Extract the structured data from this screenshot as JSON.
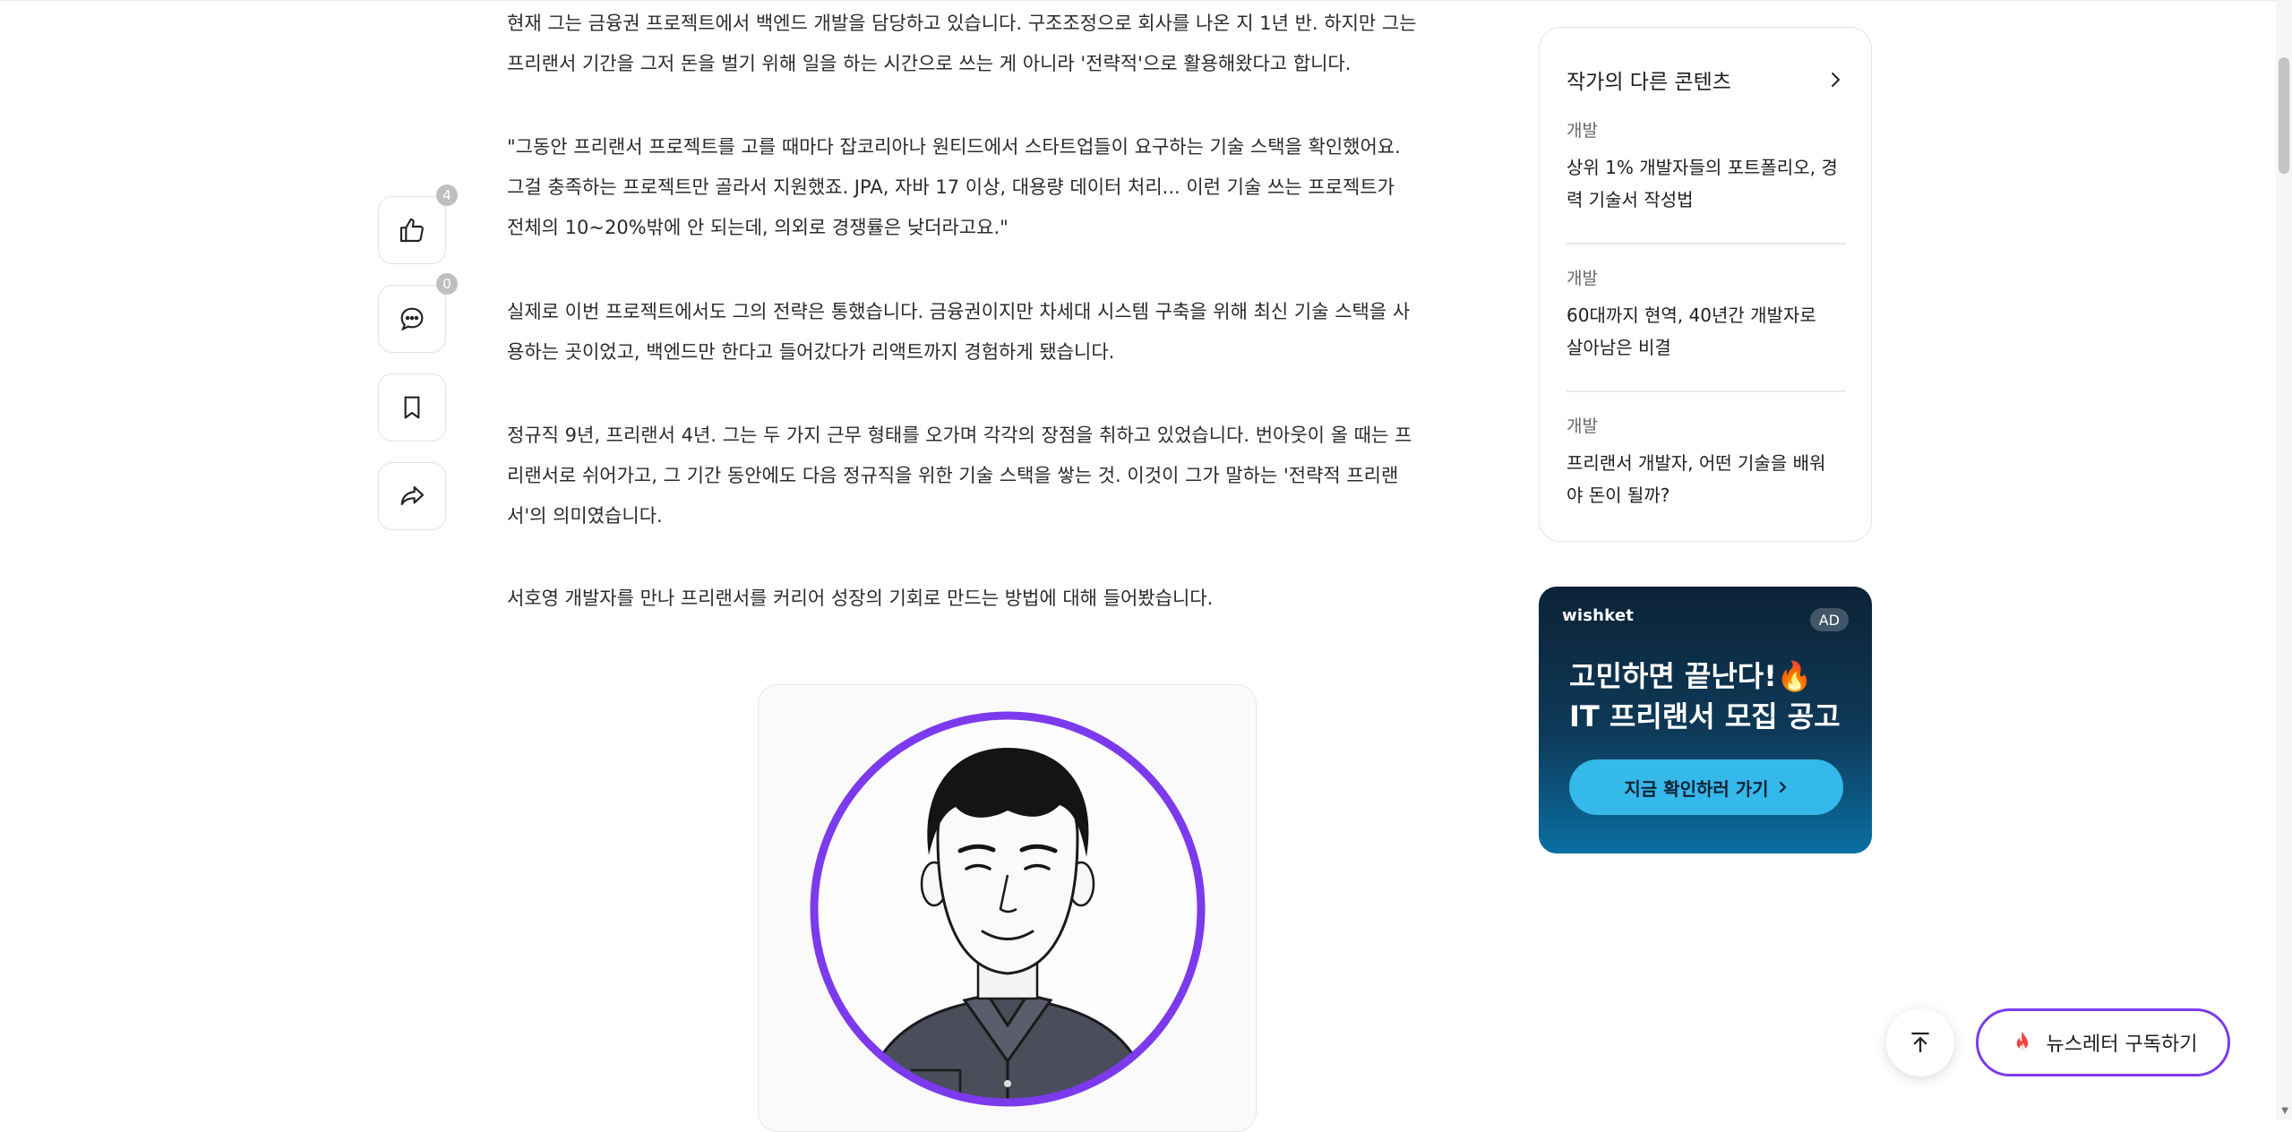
{
  "rail": {
    "like_count": "4",
    "comment_count": "0"
  },
  "article": {
    "paragraphs": [
      [
        "현재 그는 금융권 프로젝트에서 백엔드 개발을 담당하고 있습니다. 구조조정으로 회사를 나온 지 1년 반. 하지만 그는",
        "프리랜서 기간을 그저 돈을 벌기 위해 일을 하는 시간으로 쓰는 게 아니라 '전략적'으로 활용해왔다고 합니다."
      ],
      [
        "\"그동안 프리랜서 프로젝트를 고를 때마다 잡코리아나 원티드에서 스타트업들이 요구하는 기술 스택을 확인했어요.",
        "그걸 충족하는 프로젝트만 골라서 지원했죠. JPA, 자바 17 이상, 대용량 데이터 처리... 이런 기술 쓰는 프로젝트가",
        "전체의 10~20%밖에 안 되는데, 의외로 경쟁률은 낮더라고요.\""
      ],
      [
        "실제로 이번 프로젝트에서도 그의 전략은 통했습니다. 금융권이지만 차세대 시스템 구축을 위해 최신 기술 스택을 사",
        "용하는 곳이었고, 백엔드만 한다고 들어갔다가 리액트까지 경험하게 됐습니다."
      ],
      [
        "정규직 9년, 프리랜서 4년. 그는 두 가지 근무 형태를 오가며 각각의 장점을 취하고 있었습니다. 번아웃이 올 때는 프",
        "리랜서로 쉬어가고, 그 기간 동안에도 다음 정규직을 위한 기술 스택을 쌓는 것. 이것이 그가 말하는 '전략적 프리랜",
        "서'의 의미였습니다."
      ],
      [
        "서호영 개발자를 만나 프리랜서를 커리어 성장의 기회로 만드는 방법에 대해 들어봤습니다."
      ]
    ]
  },
  "sidebar": {
    "heading": "작가의 다른 콘텐츠",
    "items": [
      {
        "category": "개발",
        "title_lines": [
          "상위 1% 개발자들의 포트폴리오, 경",
          "력 기술서 작성법"
        ]
      },
      {
        "category": "개발",
        "title_lines": [
          "60대까지 현역, 40년간 개발자로",
          "살아남은 비결"
        ]
      },
      {
        "category": "개발",
        "title_lines": [
          "프리랜서 개발자, 어떤 기술을 배워",
          "야 돈이 될까?"
        ]
      }
    ]
  },
  "ad": {
    "brand": "wishket",
    "badge": "AD",
    "headline_line1": "고민하면 끝난다!🔥",
    "headline_line2": "IT 프리랜서 모집 공고",
    "cta": "지금 확인하러 가기",
    "cta_icon": "chevron-right-icon"
  },
  "floating": {
    "newsletter_label": "뉴스레터 구독하기",
    "newsletter_icon": "fire-icon",
    "scroll_top_icon": "arrow-up-to-top-icon"
  },
  "colors": {
    "accent_purple": "#7c3aed",
    "ad_cta": "#35b8ea",
    "ad_bg_dark": "#0b2236"
  }
}
